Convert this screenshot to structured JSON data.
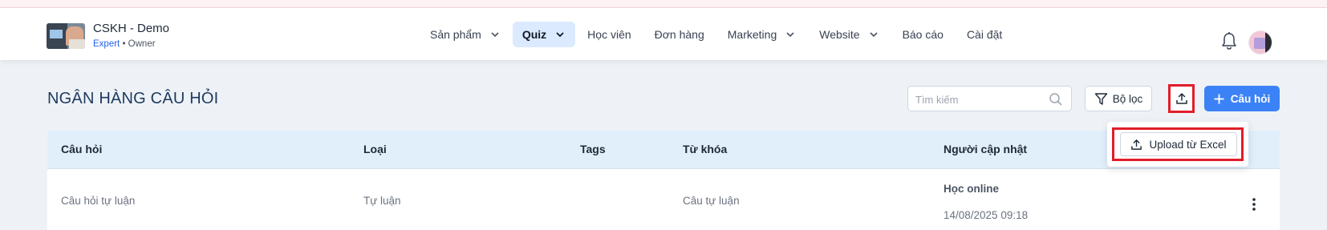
{
  "header": {
    "brand_name": "CSKH - Demo",
    "plan": "Expert",
    "role_separator": " • ",
    "role": "Owner",
    "nav": [
      {
        "label": "Sản phẩm",
        "has_dropdown": true,
        "active": false
      },
      {
        "label": "Quiz",
        "has_dropdown": true,
        "active": true
      },
      {
        "label": "Học viên",
        "has_dropdown": false,
        "active": false
      },
      {
        "label": "Đơn hàng",
        "has_dropdown": false,
        "active": false
      },
      {
        "label": "Marketing",
        "has_dropdown": true,
        "active": false
      },
      {
        "label": "Website",
        "has_dropdown": true,
        "active": false
      },
      {
        "label": "Báo cáo",
        "has_dropdown": false,
        "active": false
      },
      {
        "label": "Cài đặt",
        "has_dropdown": false,
        "active": false
      }
    ],
    "icons": {
      "notifications": "bell-icon",
      "avatar": "user-avatar"
    }
  },
  "page": {
    "title": "NGÂN HÀNG CÂU HỎI",
    "search_placeholder": "Tìm kiếm",
    "filter_label": "Bộ lọc",
    "add_label": "Câu hỏi",
    "upload_menu_item": "Upload từ Excel"
  },
  "table": {
    "columns": [
      "Câu hỏi",
      "Loại",
      "Tags",
      "Từ khóa",
      "Người cập nhật"
    ],
    "rows": [
      {
        "question": "Câu hỏi tự luận",
        "type": "Tự luận",
        "tags": "",
        "keyword": "Câu tự luận",
        "updated_by": "Học online",
        "updated_at": "14/08/2025 09:18"
      }
    ]
  },
  "colors": {
    "accent": "#3b82f6",
    "active_nav_bg": "#dbeafe",
    "title": "#1e3a5f",
    "table_header_bg": "#e1effb",
    "highlight": "#e11d2a"
  }
}
